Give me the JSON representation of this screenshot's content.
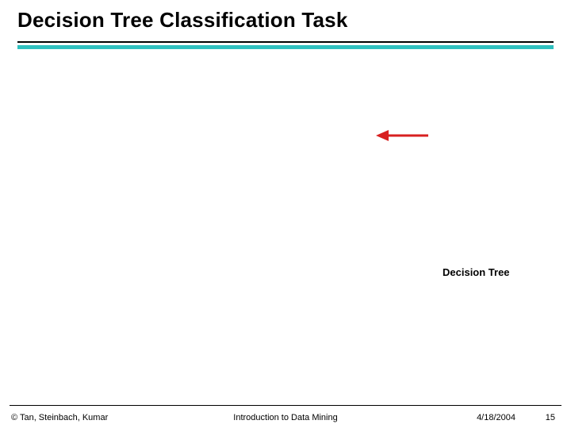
{
  "title": "Decision Tree Classification Task",
  "caption": "Decision Tree",
  "arrow": {
    "color": "#d82020"
  },
  "footer": {
    "copyright": "© Tan, Steinbach, Kumar",
    "center": "Introduction to Data Mining",
    "date": "4/18/2004",
    "page": "15"
  }
}
